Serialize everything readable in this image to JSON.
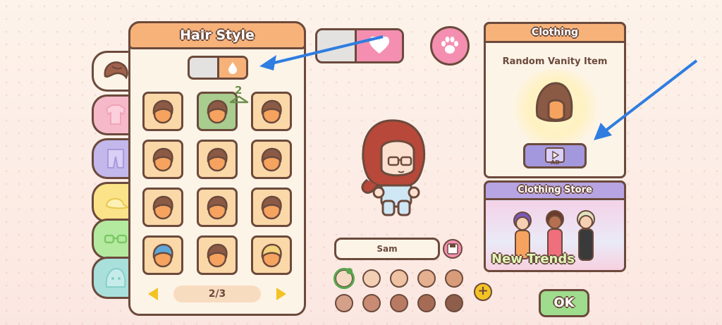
{
  "hair_panel": {
    "title": "Hair Style",
    "page": "2/3",
    "badge_count": "2",
    "toggle_icon": "droplet-icon",
    "hair_items": [
      {
        "name": "hair-short-swept",
        "selected": false
      },
      {
        "name": "hair-bob",
        "selected": true
      },
      {
        "name": "hair-spiky",
        "selected": false
      },
      {
        "name": "hair-buns",
        "selected": false
      },
      {
        "name": "hair-bowl",
        "selected": false
      },
      {
        "name": "hair-messy",
        "selected": false
      },
      {
        "name": "hair-long",
        "selected": false
      },
      {
        "name": "hair-side-part",
        "selected": false
      },
      {
        "name": "hair-mop",
        "selected": false
      },
      {
        "name": "hair-shark-hood",
        "selected": false
      },
      {
        "name": "hair-updo",
        "selected": false
      },
      {
        "name": "hair-lion-mask",
        "selected": false
      }
    ]
  },
  "category_tabs": [
    "hair-icon",
    "shirt-icon",
    "pants-icon",
    "hat-icon",
    "glasses-icon",
    "face-icon"
  ],
  "character": {
    "name": "Sam"
  },
  "skin_tones": [
    "#f6dbc4",
    "#f3cfb4",
    "#eec2a2",
    "#e5b08f",
    "#d99c7a",
    "#d4a08a",
    "#c98b73",
    "#b97a63",
    "#a66b55",
    "#8e5d4b"
  ],
  "clothing_panel": {
    "title": "Clothing",
    "subtitle": "Random Vanity Item",
    "ad_label": "AD"
  },
  "store_panel": {
    "title": "Clothing Store",
    "banner": "New Trends"
  },
  "ok_button": "OK",
  "colors": {
    "accent_orange": "#f7b27a",
    "outline": "#6b4a3c",
    "pink": "#f48fb1",
    "purple": "#b7a4e3",
    "green_ok": "#9fdc8d",
    "arrow_blue": "#2f7de0"
  }
}
